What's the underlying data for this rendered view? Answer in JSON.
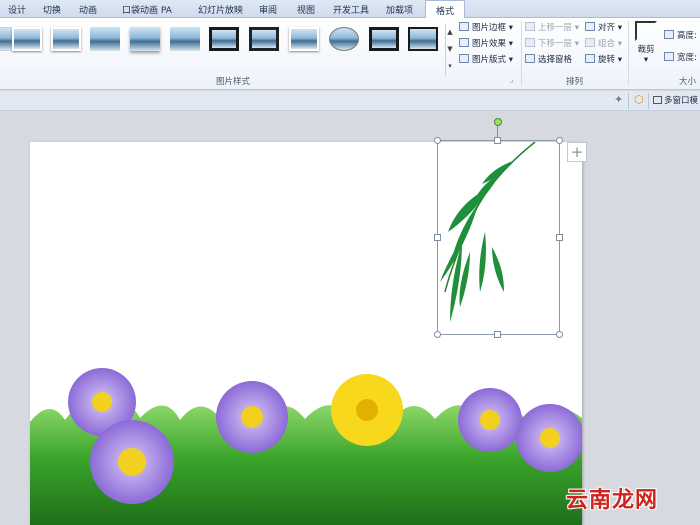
{
  "tabs": [
    {
      "label": "设计",
      "active": false
    },
    {
      "label": "切换",
      "active": false
    },
    {
      "label": "动画",
      "active": false
    },
    {
      "label": "口袋动画 PA",
      "active": false
    },
    {
      "label": "幻灯片放映",
      "active": false
    },
    {
      "label": "审阅",
      "active": false
    },
    {
      "label": "视图",
      "active": false
    },
    {
      "label": "开发工具",
      "active": false
    },
    {
      "label": "加载项",
      "active": false
    },
    {
      "label": "格式",
      "active": true
    }
  ],
  "picture_styles": {
    "group_label": "图片样式",
    "border_label": "图片边框",
    "effects_label": "图片效果",
    "layout_label": "图片版式"
  },
  "arrange": {
    "group_label": "排列",
    "bring_forward": "上移一层",
    "send_backward": "下移一层",
    "selection_pane": "选择窗格",
    "align": "对齐",
    "group": "组合",
    "rotate": "旋转"
  },
  "size": {
    "group_label": "大小",
    "crop_label": "裁剪",
    "height_label": "高度:",
    "width_label": "宽度:"
  },
  "strip": {
    "multi_window": "多窗口模"
  },
  "slide": {
    "plus_symbol": "+"
  },
  "watermark": {
    "text": "云南龙网"
  },
  "colors": {
    "accent": "#1e3050",
    "watermark": "#d0221f",
    "leaf": "#1f8f3a",
    "grass": "#3aa52a",
    "daisy_purple": "#a98ae0",
    "daisy_yellow": "#f2d020"
  }
}
